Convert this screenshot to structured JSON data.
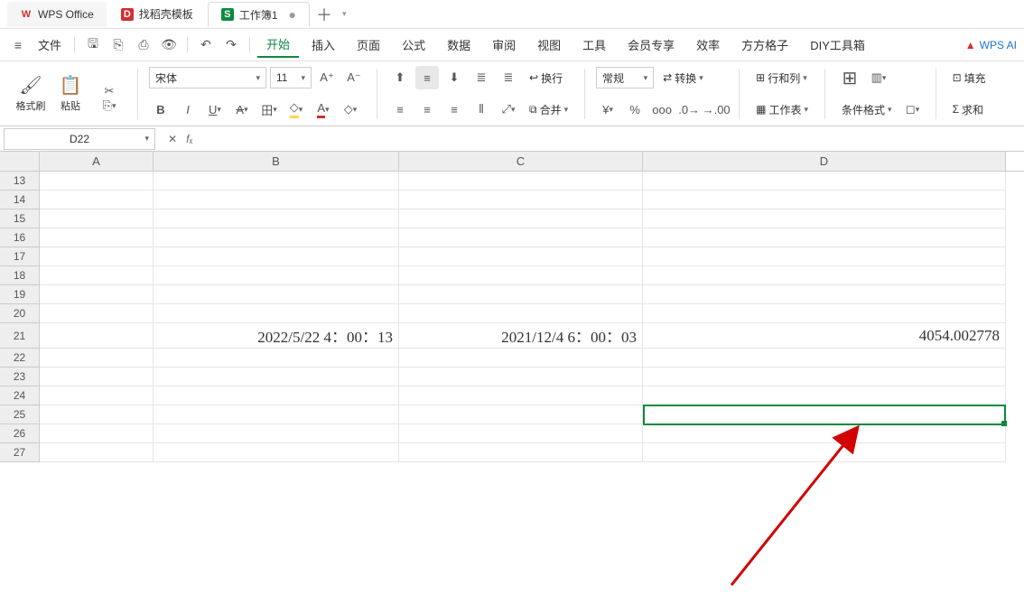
{
  "titlebar": {
    "app": "WPS Office",
    "tabs": [
      {
        "icon": "D",
        "label": "找稻壳模板"
      },
      {
        "icon": "S",
        "label": "工作簿1",
        "modified": "●"
      }
    ]
  },
  "quickbar": {
    "file": "文件"
  },
  "menu": [
    "开始",
    "插入",
    "页面",
    "公式",
    "数据",
    "审阅",
    "视图",
    "工具",
    "会员专享",
    "效率",
    "方方格子",
    "DIY工具箱"
  ],
  "wpsai": "WPS AI",
  "ribbon": {
    "format_painter": "格式刷",
    "paste": "粘贴",
    "font_name": "宋体",
    "font_size": "11",
    "wrap": "换行",
    "merge": "合并",
    "number_format": "常规",
    "convert": "转换",
    "rowcol": "行和列",
    "sheet": "工作表",
    "cond_format": "条件格式",
    "fill": "填充",
    "sum": "求和"
  },
  "namebox": "D22",
  "columns": [
    "A",
    "B",
    "C",
    "D"
  ],
  "rows_start": 13,
  "rows_end": 27,
  "cells": {
    "B21": "2022/5/22 4：00：13",
    "C21": "2021/12/4 6：00：03",
    "D21": "4054.002778"
  }
}
